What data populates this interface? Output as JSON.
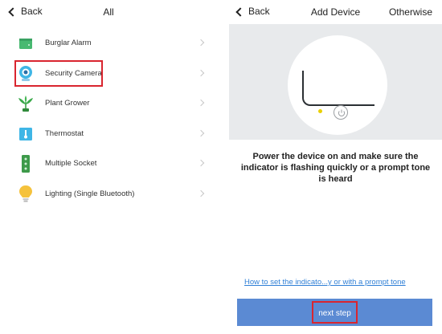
{
  "left_screen": {
    "back_label": "Back",
    "title": "All",
    "devices": [
      {
        "label": "Burglar Alarm",
        "icon": "burglar-alarm-icon"
      },
      {
        "label": "Security Camera",
        "icon": "security-camera-icon"
      },
      {
        "label": "Plant Grower",
        "icon": "plant-grower-icon"
      },
      {
        "label": "Thermostat",
        "icon": "thermostat-icon"
      },
      {
        "label": "Multiple Socket",
        "icon": "multiple-socket-icon"
      },
      {
        "label": "Lighting (Single Bluetooth)",
        "icon": "light-bulb-icon"
      }
    ]
  },
  "right_screen": {
    "back_label": "Back",
    "title": "Add Device",
    "otherwise_label": "Otherwise",
    "instruction": "Power the device on and make sure the indicator is flashing quickly or a prompt tone is heard",
    "help_link": "How to set the indicato...y or with a  prompt tone",
    "next_button": "next step"
  },
  "colors": {
    "highlight_box": "#d9252f",
    "next_button_bg": "#5b8ad3",
    "link": "#2f7fd6",
    "indicator_led": "#e9d000"
  }
}
